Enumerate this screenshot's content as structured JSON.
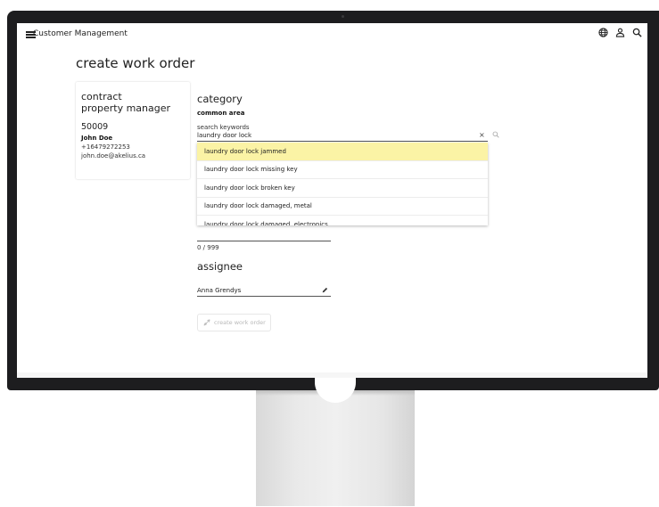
{
  "app": {
    "title": "Customer Management"
  },
  "page": {
    "title": "create work order"
  },
  "contract": {
    "heading_line1": "contract",
    "heading_line2": "property manager",
    "id": "50009",
    "name": "John Doe",
    "phone": "+16479272253",
    "email": "john.doe@akelius.ca"
  },
  "category": {
    "title": "category",
    "subtitle": "common area",
    "search_label": "search keywords",
    "search_value": "laundry door lock",
    "clear_glyph": "×",
    "suggestions": [
      "laundry door lock jammed",
      "laundry door lock missing key",
      "laundry door lock broken key",
      "laundry door lock damaged, metal",
      "laundry door lock damaged, electronics"
    ]
  },
  "description": {
    "char_count": "0 / 999"
  },
  "assignee": {
    "title": "assignee",
    "value": "Anna Grendys"
  },
  "actions": {
    "create_label": "create work order"
  },
  "colors": {
    "highlight": "#fbf3a5",
    "bezel": "#1d1d1f"
  },
  "icons": [
    "menu-icon",
    "globe-icon",
    "user-icon",
    "search-icon",
    "clear-icon",
    "pencil-icon",
    "send-icon"
  ]
}
